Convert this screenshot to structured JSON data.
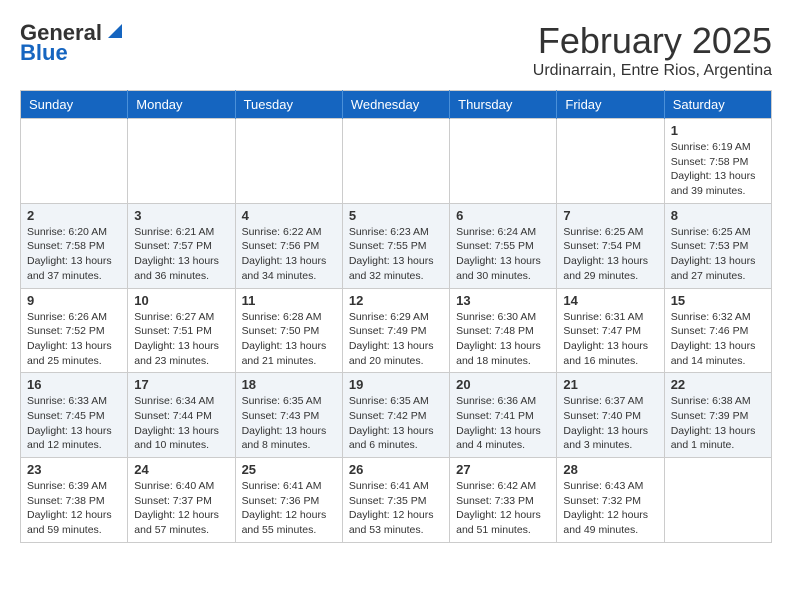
{
  "header": {
    "logo_general": "General",
    "logo_blue": "Blue",
    "month_title": "February 2025",
    "location": "Urdinarrain, Entre Rios, Argentina"
  },
  "days_of_week": [
    "Sunday",
    "Monday",
    "Tuesday",
    "Wednesday",
    "Thursday",
    "Friday",
    "Saturday"
  ],
  "weeks": [
    [
      {
        "day": "",
        "info": ""
      },
      {
        "day": "",
        "info": ""
      },
      {
        "day": "",
        "info": ""
      },
      {
        "day": "",
        "info": ""
      },
      {
        "day": "",
        "info": ""
      },
      {
        "day": "",
        "info": ""
      },
      {
        "day": "1",
        "info": "Sunrise: 6:19 AM\nSunset: 7:58 PM\nDaylight: 13 hours\nand 39 minutes."
      }
    ],
    [
      {
        "day": "2",
        "info": "Sunrise: 6:20 AM\nSunset: 7:58 PM\nDaylight: 13 hours\nand 37 minutes."
      },
      {
        "day": "3",
        "info": "Sunrise: 6:21 AM\nSunset: 7:57 PM\nDaylight: 13 hours\nand 36 minutes."
      },
      {
        "day": "4",
        "info": "Sunrise: 6:22 AM\nSunset: 7:56 PM\nDaylight: 13 hours\nand 34 minutes."
      },
      {
        "day": "5",
        "info": "Sunrise: 6:23 AM\nSunset: 7:55 PM\nDaylight: 13 hours\nand 32 minutes."
      },
      {
        "day": "6",
        "info": "Sunrise: 6:24 AM\nSunset: 7:55 PM\nDaylight: 13 hours\nand 30 minutes."
      },
      {
        "day": "7",
        "info": "Sunrise: 6:25 AM\nSunset: 7:54 PM\nDaylight: 13 hours\nand 29 minutes."
      },
      {
        "day": "8",
        "info": "Sunrise: 6:25 AM\nSunset: 7:53 PM\nDaylight: 13 hours\nand 27 minutes."
      }
    ],
    [
      {
        "day": "9",
        "info": "Sunrise: 6:26 AM\nSunset: 7:52 PM\nDaylight: 13 hours\nand 25 minutes."
      },
      {
        "day": "10",
        "info": "Sunrise: 6:27 AM\nSunset: 7:51 PM\nDaylight: 13 hours\nand 23 minutes."
      },
      {
        "day": "11",
        "info": "Sunrise: 6:28 AM\nSunset: 7:50 PM\nDaylight: 13 hours\nand 21 minutes."
      },
      {
        "day": "12",
        "info": "Sunrise: 6:29 AM\nSunset: 7:49 PM\nDaylight: 13 hours\nand 20 minutes."
      },
      {
        "day": "13",
        "info": "Sunrise: 6:30 AM\nSunset: 7:48 PM\nDaylight: 13 hours\nand 18 minutes."
      },
      {
        "day": "14",
        "info": "Sunrise: 6:31 AM\nSunset: 7:47 PM\nDaylight: 13 hours\nand 16 minutes."
      },
      {
        "day": "15",
        "info": "Sunrise: 6:32 AM\nSunset: 7:46 PM\nDaylight: 13 hours\nand 14 minutes."
      }
    ],
    [
      {
        "day": "16",
        "info": "Sunrise: 6:33 AM\nSunset: 7:45 PM\nDaylight: 13 hours\nand 12 minutes."
      },
      {
        "day": "17",
        "info": "Sunrise: 6:34 AM\nSunset: 7:44 PM\nDaylight: 13 hours\nand 10 minutes."
      },
      {
        "day": "18",
        "info": "Sunrise: 6:35 AM\nSunset: 7:43 PM\nDaylight: 13 hours\nand 8 minutes."
      },
      {
        "day": "19",
        "info": "Sunrise: 6:35 AM\nSunset: 7:42 PM\nDaylight: 13 hours\nand 6 minutes."
      },
      {
        "day": "20",
        "info": "Sunrise: 6:36 AM\nSunset: 7:41 PM\nDaylight: 13 hours\nand 4 minutes."
      },
      {
        "day": "21",
        "info": "Sunrise: 6:37 AM\nSunset: 7:40 PM\nDaylight: 13 hours\nand 3 minutes."
      },
      {
        "day": "22",
        "info": "Sunrise: 6:38 AM\nSunset: 7:39 PM\nDaylight: 13 hours\nand 1 minute."
      }
    ],
    [
      {
        "day": "23",
        "info": "Sunrise: 6:39 AM\nSunset: 7:38 PM\nDaylight: 12 hours\nand 59 minutes."
      },
      {
        "day": "24",
        "info": "Sunrise: 6:40 AM\nSunset: 7:37 PM\nDaylight: 12 hours\nand 57 minutes."
      },
      {
        "day": "25",
        "info": "Sunrise: 6:41 AM\nSunset: 7:36 PM\nDaylight: 12 hours\nand 55 minutes."
      },
      {
        "day": "26",
        "info": "Sunrise: 6:41 AM\nSunset: 7:35 PM\nDaylight: 12 hours\nand 53 minutes."
      },
      {
        "day": "27",
        "info": "Sunrise: 6:42 AM\nSunset: 7:33 PM\nDaylight: 12 hours\nand 51 minutes."
      },
      {
        "day": "28",
        "info": "Sunrise: 6:43 AM\nSunset: 7:32 PM\nDaylight: 12 hours\nand 49 minutes."
      },
      {
        "day": "",
        "info": ""
      }
    ]
  ]
}
